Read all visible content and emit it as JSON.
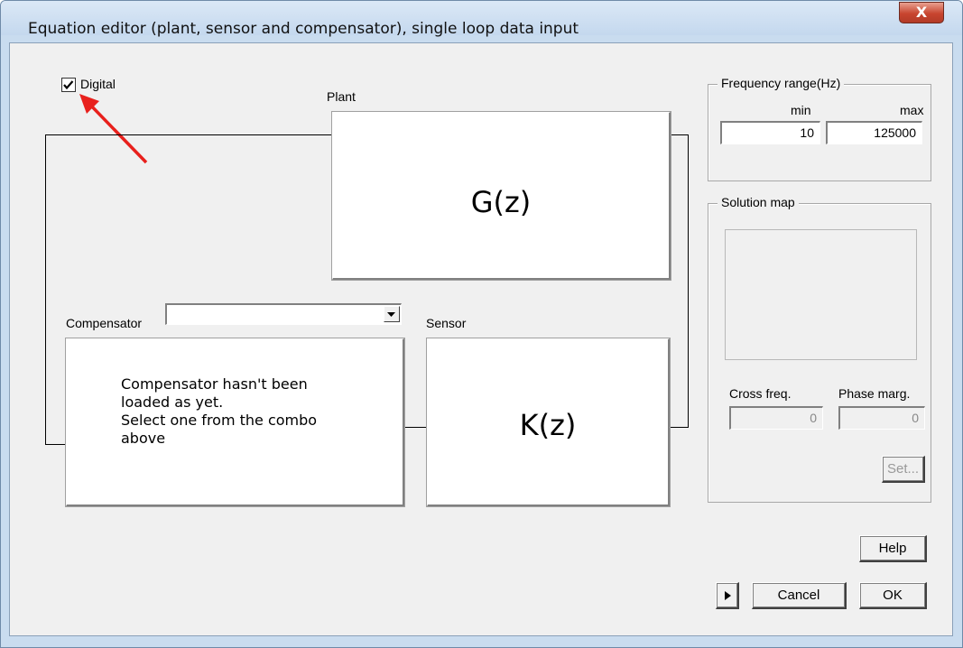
{
  "window": {
    "title": "Equation editor (plant, sensor and compensator), single loop data input",
    "close_label": "X"
  },
  "digital": {
    "label": "Digital",
    "checked": true
  },
  "plant": {
    "label": "Plant",
    "expr": "G(z)"
  },
  "compensator": {
    "label": "Compensator",
    "combo_value": "",
    "message_lines": [
      "Compensator hasn't been",
      "loaded as yet.",
      "Select one from the combo",
      "above"
    ]
  },
  "sensor": {
    "label": "Sensor",
    "expr": "K(z)"
  },
  "frequency": {
    "title": "Frequency range(Hz)",
    "min_label": "min",
    "max_label": "max",
    "min_value": "10",
    "max_value": "125000"
  },
  "solution": {
    "title": "Solution map",
    "cross_label": "Cross freq.",
    "phase_label": "Phase marg.",
    "cross_value": "0",
    "phase_value": "0",
    "set_label": "Set..."
  },
  "buttons": {
    "help": "Help",
    "cancel": "Cancel",
    "ok": "OK"
  },
  "colors": {
    "annotation_arrow": "#e8201c",
    "close_button": "#c8452f"
  }
}
